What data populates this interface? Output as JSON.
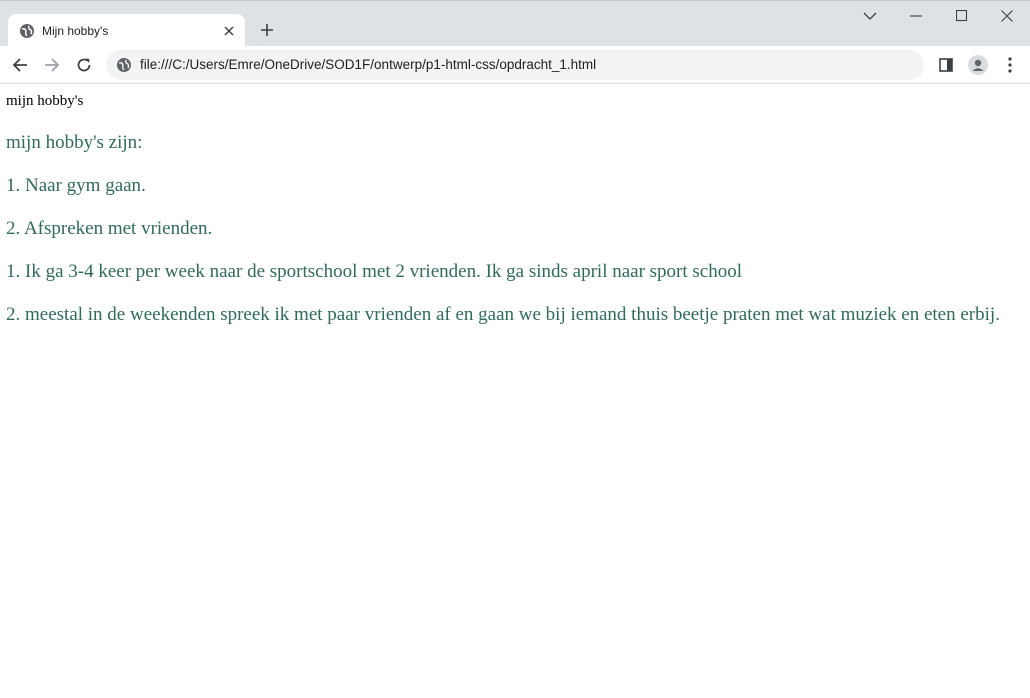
{
  "browser": {
    "tab": {
      "title": "Mijn hobby's",
      "favicon": "globe-icon"
    },
    "new_tab_icon": "plus-icon",
    "window_controls": [
      "tab-search-icon",
      "minimize-icon",
      "maximize-icon",
      "close-icon"
    ],
    "address": {
      "icon": "globe-icon",
      "url": "file:///C:/Users/Emre/OneDrive/SOD1F/ontwerp/p1-html-css/opdracht_1.html"
    }
  },
  "page": {
    "heading": "mijn hobby's",
    "text_color": "#2e6b5a",
    "lines": [
      "mijn hobby's zijn:",
      "1. Naar gym gaan.",
      "2. Afspreken met vrienden.",
      "1. Ik ga 3-4 keer per week naar de sportschool met 2 vrienden. Ik ga sinds april naar sport school",
      "2. meestal in de weekenden spreek ik met paar vrienden af en gaan we bij iemand thuis beetje praten met wat muziek en eten erbij."
    ]
  }
}
